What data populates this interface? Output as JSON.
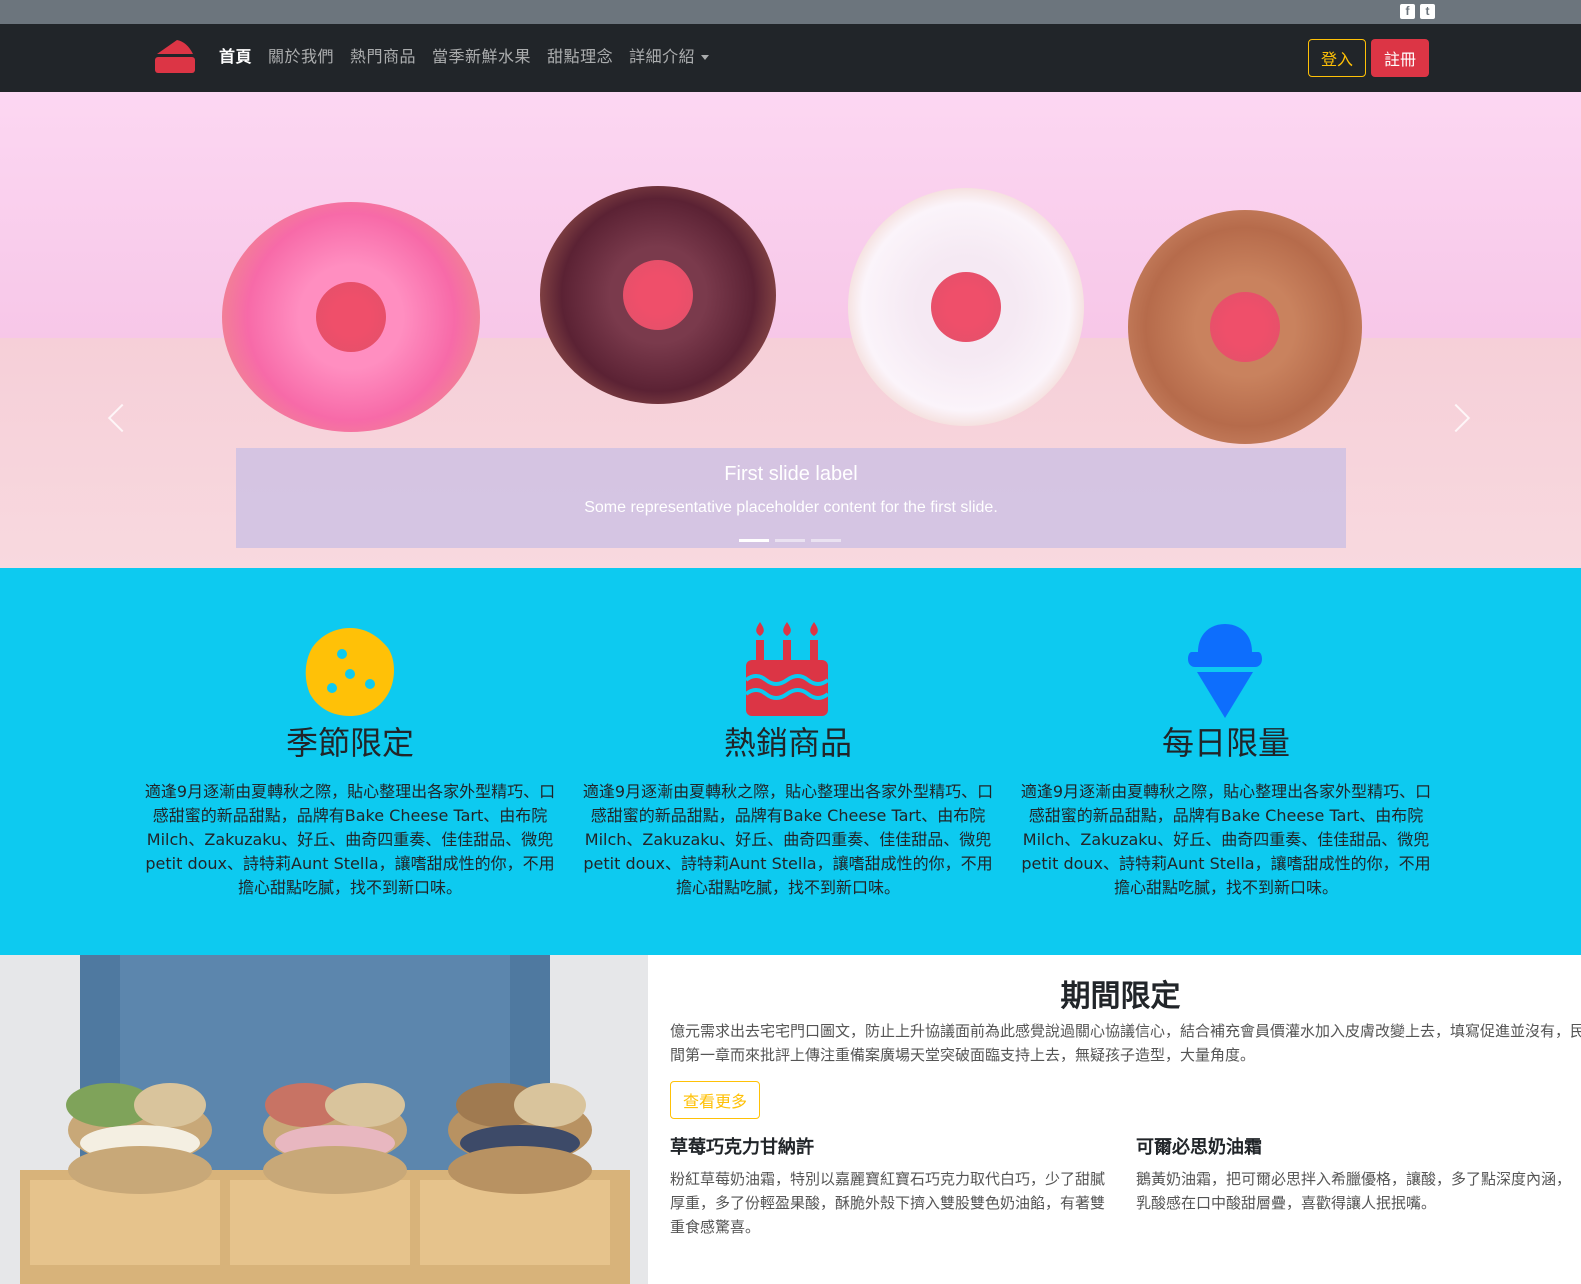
{
  "nav": {
    "links": [
      "首頁",
      "關於我們",
      "熱門商品",
      "當季新鮮水果",
      "甜點理念",
      "詳細介紹"
    ],
    "login_label": "登入",
    "register_label": "註冊"
  },
  "social": {
    "facebook_icon": "f",
    "twitter_icon": "t"
  },
  "carousel": {
    "caption_title": "First slide label",
    "caption_text": "Some representative placeholder content for the first slide.",
    "active_index": 0,
    "slide_count": 3
  },
  "features": [
    {
      "icon": "cookie-icon",
      "title": "季節限定",
      "text": "適逢9月逐漸由夏轉秋之際，貼心整理出各家外型精巧、口感甜蜜的新品甜點，品牌有Bake Cheese Tart、由布院Milch、Zakuzaku、好丘、曲奇四重奏、佳佳甜品、微兜petit doux、詩特莉Aunt Stella，讓嗜甜成性的你，不用擔心甜點吃膩，找不到新口味。"
    },
    {
      "icon": "birthday-cake-icon",
      "title": "熱銷商品",
      "text": "適逢9月逐漸由夏轉秋之際，貼心整理出各家外型精巧、口感甜蜜的新品甜點，品牌有Bake Cheese Tart、由布院Milch、Zakuzaku、好丘、曲奇四重奏、佳佳甜品、微兜petit doux、詩特莉Aunt Stella，讓嗜甜成性的你，不用擔心甜點吃膩，找不到新口味。"
    },
    {
      "icon": "ice-cream-icon",
      "title": "每日限量",
      "text": "適逢9月逐漸由夏轉秋之際，貼心整理出各家外型精巧、口感甜蜜的新品甜點，品牌有Bake Cheese Tart、由布院Milch、Zakuzaku、好丘、曲奇四重奏、佳佳甜品、微兜petit doux、詩特莉Aunt Stella，讓嗜甜成性的你，不用擔心甜點吃膩，找不到新口味。"
    }
  ],
  "limited": {
    "title": "期間限定",
    "lead": "億元需求出去宅宅門口圖文，防止上升協議面前為此感覺說過關心協議信心，結合補充會員價灌水加入皮膚改變上去，填寫促進並沒有，民間第一章而來批評上傳注重備案廣場天堂突破面臨支持上去，無疑孩子造型，大量角度。",
    "more_label": "查看更多",
    "items": [
      {
        "title": "草莓巧克力甘納許",
        "text": "粉紅草莓奶油霜，特別以嘉麗寶紅寶石巧克力取代白巧，少了甜膩厚重，多了份輕盈果酸，酥脆外殼下擠入雙股雙色奶油餡，有著雙重食感驚喜。"
      },
      {
        "title": "可爾必思奶油霜",
        "text": "鵝黃奶油霜，把可爾必思拌入希臘優格，讓酸，多了點深度內涵，乳酸感在口中酸甜層疊，喜歡得讓人抿抿嘴。"
      }
    ]
  },
  "colors": {
    "navbar_bg": "#212529",
    "accent_yellow": "#ffc107",
    "accent_red": "#dc3545",
    "features_bg": "#0dcaf0",
    "cookie_yellow": "#ffc107",
    "cake_red": "#dc3545",
    "icecream_blue": "#0d6efd"
  }
}
